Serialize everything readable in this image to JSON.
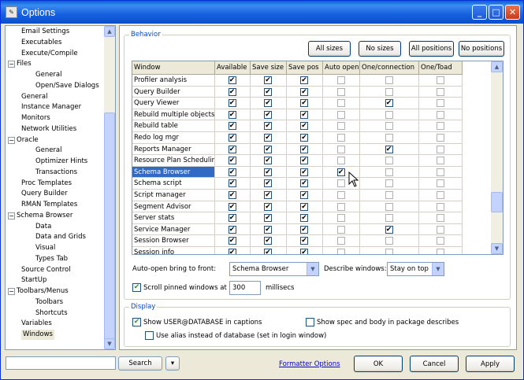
{
  "window": {
    "title": "Options",
    "minimize": "_",
    "maximize": "□",
    "close": "✕"
  },
  "tree": {
    "items": [
      {
        "label": "Email Settings",
        "level": 1
      },
      {
        "label": "Executables",
        "level": 1
      },
      {
        "label": "Execute/Compile",
        "level": 1
      },
      {
        "label": "Files",
        "level": 0,
        "expander": "−"
      },
      {
        "label": "General",
        "level": 2
      },
      {
        "label": "Open/Save Dialogs",
        "level": 2
      },
      {
        "label": "General",
        "level": 1
      },
      {
        "label": "Instance Manager",
        "level": 1
      },
      {
        "label": "Monitors",
        "level": 1
      },
      {
        "label": "Network Utilities",
        "level": 1
      },
      {
        "label": "Oracle",
        "level": 0,
        "expander": "−"
      },
      {
        "label": "General",
        "level": 2
      },
      {
        "label": "Optimizer Hints",
        "level": 2
      },
      {
        "label": "Transactions",
        "level": 2
      },
      {
        "label": "Proc Templates",
        "level": 1
      },
      {
        "label": "Query Builder",
        "level": 1
      },
      {
        "label": "RMAN Templates",
        "level": 1
      },
      {
        "label": "Schema Browser",
        "level": 0,
        "expander": "−"
      },
      {
        "label": "Data",
        "level": 2
      },
      {
        "label": "Data and Grids",
        "level": 2
      },
      {
        "label": "Visual",
        "level": 2
      },
      {
        "label": "Types Tab",
        "level": 2
      },
      {
        "label": "Source Control",
        "level": 1
      },
      {
        "label": "StartUp",
        "level": 1
      },
      {
        "label": "Toolbars/Menus",
        "level": 0,
        "expander": "−"
      },
      {
        "label": "Toolbars",
        "level": 2
      },
      {
        "label": "Shortcuts",
        "level": 2
      },
      {
        "label": "Variables",
        "level": 1
      },
      {
        "label": "Windows",
        "level": 1,
        "selected": true
      }
    ]
  },
  "behavior": {
    "legend": "Behavior",
    "buttons": [
      "All sizes",
      "No sizes",
      "All positions",
      "No positions"
    ]
  },
  "grid": {
    "columns": [
      "Window",
      "Available",
      "Save size",
      "Save pos",
      "Auto open",
      "One/connection",
      "One/Toad"
    ],
    "rows": [
      {
        "name": "Profiler analysis",
        "checks": [
          1,
          1,
          1,
          0,
          0,
          0
        ]
      },
      {
        "name": "Query Builder",
        "checks": [
          1,
          1,
          1,
          0,
          0,
          0
        ]
      },
      {
        "name": "Query Viewer",
        "checks": [
          1,
          1,
          1,
          0,
          1,
          0
        ]
      },
      {
        "name": "Rebuild multiple objects",
        "checks": [
          1,
          1,
          1,
          0,
          0,
          0
        ]
      },
      {
        "name": "Rebuild table",
        "checks": [
          1,
          1,
          1,
          0,
          0,
          0
        ]
      },
      {
        "name": "Redo log mgr",
        "checks": [
          1,
          1,
          1,
          0,
          0,
          0
        ]
      },
      {
        "name": "Reports Manager",
        "checks": [
          1,
          1,
          1,
          0,
          1,
          0
        ]
      },
      {
        "name": "Resource Plan Scheduling",
        "checks": [
          1,
          1,
          1,
          0,
          0,
          0
        ]
      },
      {
        "name": "Schema Browser",
        "checks": [
          1,
          1,
          1,
          1,
          0,
          0
        ],
        "selected": true
      },
      {
        "name": "Schema script",
        "checks": [
          1,
          1,
          1,
          0,
          0,
          0
        ]
      },
      {
        "name": "Script manager",
        "checks": [
          1,
          1,
          1,
          0,
          0,
          0
        ]
      },
      {
        "name": "Segment Advisor",
        "checks": [
          1,
          1,
          1,
          0,
          0,
          0
        ]
      },
      {
        "name": "Server stats",
        "checks": [
          1,
          1,
          1,
          0,
          0,
          0
        ]
      },
      {
        "name": "Service Manager",
        "checks": [
          1,
          1,
          1,
          0,
          1,
          0
        ]
      },
      {
        "name": "Session Browser",
        "checks": [
          1,
          1,
          1,
          0,
          0,
          0
        ]
      },
      {
        "name": "Session info",
        "checks": [
          1,
          1,
          1,
          0,
          0,
          0
        ]
      }
    ]
  },
  "autoopen": {
    "label": "Auto-open bring to front:",
    "value": "Schema Browser",
    "describe_label": "Describe windows:",
    "describe_value": "Stay on top"
  },
  "scroll": {
    "label": "Scroll pinned windows at",
    "value": "300",
    "unit": "millisecs",
    "checked": true
  },
  "display": {
    "legend": "Display",
    "show_user": "Show USER@DATABASE in captions",
    "show_spec": "Show spec and body in package describes",
    "use_alias": "Use alias instead of database (set in login window)",
    "show_user_checked": true,
    "show_spec_checked": false,
    "use_alias_checked": false
  },
  "footer": {
    "search_placeholder": "",
    "search_button": "Search",
    "dropdown": "▾",
    "formatter_link": "Formatter Options",
    "ok": "OK",
    "cancel": "Cancel",
    "apply": "Apply"
  }
}
